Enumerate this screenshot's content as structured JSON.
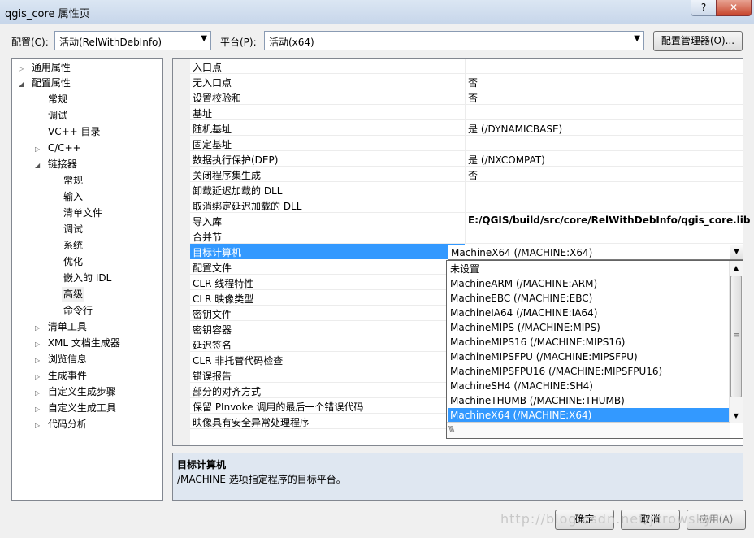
{
  "window": {
    "title": "qgis_core 属性页",
    "help_glyph": "?",
    "close_glyph": "✕"
  },
  "header": {
    "config_label": "配置(C):",
    "config_value": "活动(RelWithDebInfo)",
    "platform_label": "平台(P):",
    "platform_value": "活动(x64)",
    "config_manager_label": "配置管理器(O)..."
  },
  "tree": {
    "items": [
      {
        "label": "通用属性",
        "twisty": "▷"
      },
      {
        "label": "配置属性",
        "twisty": "◢"
      },
      {
        "label": "常规",
        "twisty": ""
      },
      {
        "label": "调试",
        "twisty": ""
      },
      {
        "label": "VC++ 目录",
        "twisty": ""
      },
      {
        "label": "C/C++",
        "twisty": "▷"
      },
      {
        "label": "链接器",
        "twisty": "◢"
      },
      {
        "label": "常规",
        "twisty": ""
      },
      {
        "label": "输入",
        "twisty": ""
      },
      {
        "label": "清单文件",
        "twisty": ""
      },
      {
        "label": "调试",
        "twisty": ""
      },
      {
        "label": "系统",
        "twisty": ""
      },
      {
        "label": "优化",
        "twisty": ""
      },
      {
        "label": "嵌入的 IDL",
        "twisty": ""
      },
      {
        "label": "高级",
        "twisty": ""
      },
      {
        "label": "命令行",
        "twisty": ""
      },
      {
        "label": "清单工具",
        "twisty": "▷"
      },
      {
        "label": "XML 文档生成器",
        "twisty": "▷"
      },
      {
        "label": "浏览信息",
        "twisty": "▷"
      },
      {
        "label": "生成事件",
        "twisty": "▷"
      },
      {
        "label": "自定义生成步骤",
        "twisty": "▷"
      },
      {
        "label": "自定义生成工具",
        "twisty": "▷"
      },
      {
        "label": "代码分析",
        "twisty": "▷"
      }
    ],
    "selected_index": 14
  },
  "grid": {
    "rows": [
      {
        "name": "入口点",
        "value": ""
      },
      {
        "name": "无入口点",
        "value": "否"
      },
      {
        "name": "设置校验和",
        "value": "否"
      },
      {
        "name": "基址",
        "value": ""
      },
      {
        "name": "随机基址",
        "value": "是 (/DYNAMICBASE)"
      },
      {
        "name": "固定基址",
        "value": ""
      },
      {
        "name": "数据执行保护(DEP)",
        "value": "是 (/NXCOMPAT)"
      },
      {
        "name": "关闭程序集生成",
        "value": "否"
      },
      {
        "name": "卸载延迟加载的 DLL",
        "value": ""
      },
      {
        "name": "取消绑定延迟加载的 DLL",
        "value": ""
      },
      {
        "name": "导入库",
        "value": "E:/QGIS/build/src/core/RelWithDebInfo/qgis_core.lib"
      },
      {
        "name": "合并节",
        "value": ""
      },
      {
        "name": "目标计算机",
        "value": "MachineX64 (/MACHINE:X64)"
      },
      {
        "name": "配置文件",
        "value": ""
      },
      {
        "name": "CLR 线程特性",
        "value": ""
      },
      {
        "name": "CLR 映像类型",
        "value": ""
      },
      {
        "name": "密钥文件",
        "value": ""
      },
      {
        "name": "密钥容器",
        "value": ""
      },
      {
        "name": "延迟签名",
        "value": ""
      },
      {
        "name": "CLR 非托管代码检查",
        "value": ""
      },
      {
        "name": "错误报告",
        "value": ""
      },
      {
        "name": "部分的对齐方式",
        "value": ""
      },
      {
        "name": "保留 PInvoke 调用的最后一个错误代码",
        "value": ""
      },
      {
        "name": "映像具有安全异常处理程序",
        "value": ""
      }
    ],
    "selected_index": 12,
    "bold_index": 10
  },
  "dropdown": {
    "options": [
      "未设置",
      "MachineARM (/MACHINE:ARM)",
      "MachineEBC (/MACHINE:EBC)",
      "MachineIA64 (/MACHINE:IA64)",
      "MachineMIPS (/MACHINE:MIPS)",
      "MachineMIPS16 (/MACHINE:MIPS16)",
      "MachineMIPSFPU (/MACHINE:MIPSFPU)",
      "MachineMIPSFPU16 (/MACHINE:MIPSFPU16)",
      "MachineSH4 (/MACHINE:SH4)",
      "MachineTHUMB (/MACHINE:THUMB)",
      "MachineX64 (/MACHINE:X64)"
    ],
    "selected_index": 10
  },
  "description": {
    "title": "目标计算机",
    "text": "/MACHINE 选项指定程序的目标平台。"
  },
  "footer": {
    "ok_label": "确定",
    "cancel_label": "取消",
    "apply_label": "应用(A)"
  },
  "watermark": "http://blog.csdn.net/jcrowsky",
  "colors": {
    "selection": "#3399ff",
    "description_bg": "#dfe7f1"
  }
}
